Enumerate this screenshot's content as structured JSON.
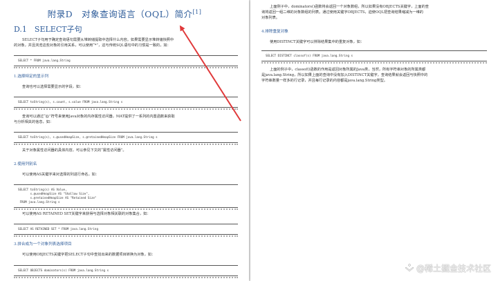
{
  "left": {
    "title": "附录D　对象查询语言（OQL）简介",
    "title_note": "[1]",
    "section_heading": "D.1　SELECT子句",
    "intro": [
      "SELECT子句用于确定查询语句需要从堆转储提取中选择什么内容。如果需要显示堆转储快照中",
      "的对象，并且浏览这些对象的引用关系，可以使用“*”，这与传统SQL语句中的习惯是一致的，如："
    ],
    "code_intro": "SELECT * FROM java.lang.String",
    "sub1_heading": "1.选择特定的显示列",
    "sub1_text": "查询也可以选择需要显示的字段，如：",
    "sub1_code": "SELECT toString(s), s.count, s.value FROM java.lang.String s",
    "sub1_text2": [
      "查询可以通过“@”符号来使用Java对象的内存属性访问器，MAT提供了一系列的内置函数来获取",
      "与分析相关的信息，如："
    ],
    "sub1_code2": "SELECT toString(s), s.@usedHeapSize, s.@retainedHeapSize FROM java.lang.String s",
    "sub1_text3": "关于对象属性访问器的具体内容，可以参见下文的“属性访问器”。",
    "sub2_heading": "2.使用列别名",
    "sub2_text": "可以使用AS关键字来对选择的列进行命名，如：",
    "sub2_code": "SELECT toString(s) AS Value,\n       s.@usedHeapSize AS \"Shallow Size\",\n       s.@retainedHeapSize AS \"Retained Size\"\n FROM java.lang.String s",
    "sub2_text2": "可以使用AS RETAINED SET关键字来获得与选择对象相关联的对象集合，如：",
    "sub2_code2": "SELECT AS RETAINED SET * FROM java.lang.String",
    "sub3_heading": "3.拼合成为一个对象列表选择项目",
    "sub3_text": "可以使用OBJECTS关键字把SELECT子句中查找出来的数据项目转换为对象，如：",
    "sub3_code": "SELECT OBJECTS dominators(s) FROM java.lang.String s"
  },
  "right": {
    "para1": [
      "上面例子中，dominators()函数将会返回一个对象数组，所以如果没有OBJECTS关键字，上面的查",
      "询将返回一组二维的对象数组的列表。通过使用关键字OBJECTS，迫使OQL把查询结果缩减为一维的",
      "对象列表。"
    ],
    "sub4_heading": "4.排除重复对象",
    "sub4_text": "使用DISTINCT关键字可以排除结果集中的重复对象，如：",
    "sub4_code": "SELECT DISTINCT classof(s) FROM java.lang.String s",
    "para2": [
      "上面的例子中，classof()函数的作用是返回对象所属的Java类，当然，所有字符串对象的所属类都",
      "是java.lang.String，所以如果上面的查询中没有加入DISTINCT关键字，查询结果就会返回与快照中的",
      "字符串数量一样多的行记录，并且每行记录的内容都是java.lang.String类型。"
    ]
  },
  "watermark": "@稀土掘金技术社区",
  "colors": {
    "heading": "#2e5c9a",
    "arrow": "#e0393a"
  }
}
